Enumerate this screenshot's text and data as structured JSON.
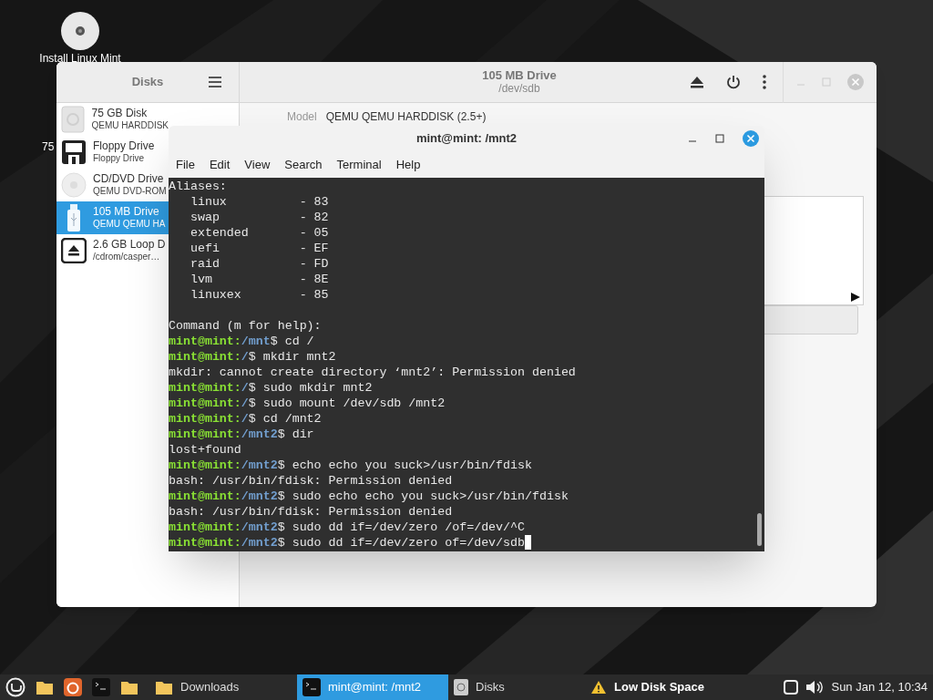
{
  "desktop": {
    "icons": [
      {
        "label": "Install Linux Mint",
        "kind": "optical"
      },
      {
        "label": "75",
        "kind": "hidden"
      }
    ]
  },
  "disks_window": {
    "title": "Disks",
    "drive_title": "105 MB Drive",
    "drive_subtitle": "/dev/sdb",
    "drives": [
      {
        "title": "75 GB Disk",
        "subtitle": "QEMU HARDDISK",
        "kind": "disk",
        "selected": false
      },
      {
        "title": "Floppy Drive",
        "subtitle": "Floppy Drive",
        "kind": "floppy",
        "selected": false
      },
      {
        "title": "CD/DVD Drive",
        "subtitle": "QEMU DVD-ROM",
        "kind": "optical",
        "selected": false
      },
      {
        "title": "105 MB Drive",
        "subtitle": "QEMU QEMU HA",
        "kind": "usb",
        "selected": true
      },
      {
        "title": "2.6 GB Loop D",
        "subtitle": "/cdrom/casper…",
        "kind": "loop",
        "selected": false
      }
    ],
    "model_label": "Model",
    "model_value": "QEMU QEMU HARDDISK (2.5+)"
  },
  "terminal": {
    "title": "mint@mint: /mnt2",
    "menu": [
      "File",
      "Edit",
      "View",
      "Search",
      "Terminal",
      "Help"
    ],
    "lines": [
      {
        "kind": "text",
        "text": "Aliases:"
      },
      {
        "kind": "text",
        "text": "   linux          - 83"
      },
      {
        "kind": "text",
        "text": "   swap           - 82"
      },
      {
        "kind": "text",
        "text": "   extended       - 05"
      },
      {
        "kind": "text",
        "text": "   uefi           - EF"
      },
      {
        "kind": "text",
        "text": "   raid           - FD"
      },
      {
        "kind": "text",
        "text": "   lvm            - 8E"
      },
      {
        "kind": "text",
        "text": "   linuxex        - 85"
      },
      {
        "kind": "blank"
      },
      {
        "kind": "text",
        "text": "Command (m for help):"
      },
      {
        "kind": "prompt",
        "user": "mint@mint:",
        "path": "/mnt",
        "command": "$ cd /"
      },
      {
        "kind": "prompt",
        "user": "mint@mint:",
        "path": "/",
        "command": "$ mkdir mnt2"
      },
      {
        "kind": "text",
        "text": "mkdir: cannot create directory ‘mnt2’: Permission denied"
      },
      {
        "kind": "prompt",
        "user": "mint@mint:",
        "path": "/",
        "command": "$ sudo mkdir mnt2"
      },
      {
        "kind": "prompt",
        "user": "mint@mint:",
        "path": "/",
        "command": "$ sudo mount /dev/sdb /mnt2"
      },
      {
        "kind": "prompt",
        "user": "mint@mint:",
        "path": "/",
        "command": "$ cd /mnt2"
      },
      {
        "kind": "prompt",
        "user": "mint@mint:",
        "path": "/mnt2",
        "command": "$ dir"
      },
      {
        "kind": "text",
        "text": "lost+found"
      },
      {
        "kind": "prompt",
        "user": "mint@mint:",
        "path": "/mnt2",
        "command": "$ echo echo you suck>/usr/bin/fdisk"
      },
      {
        "kind": "text",
        "text": "bash: /usr/bin/fdisk: Permission denied"
      },
      {
        "kind": "prompt",
        "user": "mint@mint:",
        "path": "/mnt2",
        "command": "$ sudo echo echo you suck>/usr/bin/fdisk"
      },
      {
        "kind": "text",
        "text": "bash: /usr/bin/fdisk: Permission denied"
      },
      {
        "kind": "prompt",
        "user": "mint@mint:",
        "path": "/mnt2",
        "command": "$ sudo dd if=/dev/zero /of=/dev/^C"
      },
      {
        "kind": "prompt",
        "user": "mint@mint:",
        "path": "/mnt2",
        "command": "$ sudo dd if=/dev/zero of=/dev/sdb",
        "cursor": true
      }
    ]
  },
  "taskbar": {
    "launchers": [
      {
        "kind": "mint"
      },
      {
        "kind": "folder"
      },
      {
        "kind": "firefox"
      },
      {
        "kind": "terminal"
      },
      {
        "kind": "folder"
      }
    ],
    "windows": [
      {
        "label": "Downloads",
        "kind": "folder",
        "selected": false
      },
      {
        "label": "mint@mint: /mnt2",
        "kind": "terminal",
        "selected": true
      },
      {
        "label": "Disks",
        "kind": "disks",
        "selected": false
      }
    ],
    "notification": "Low Disk Space",
    "clock": "Sun Jan 12, 10:34"
  }
}
